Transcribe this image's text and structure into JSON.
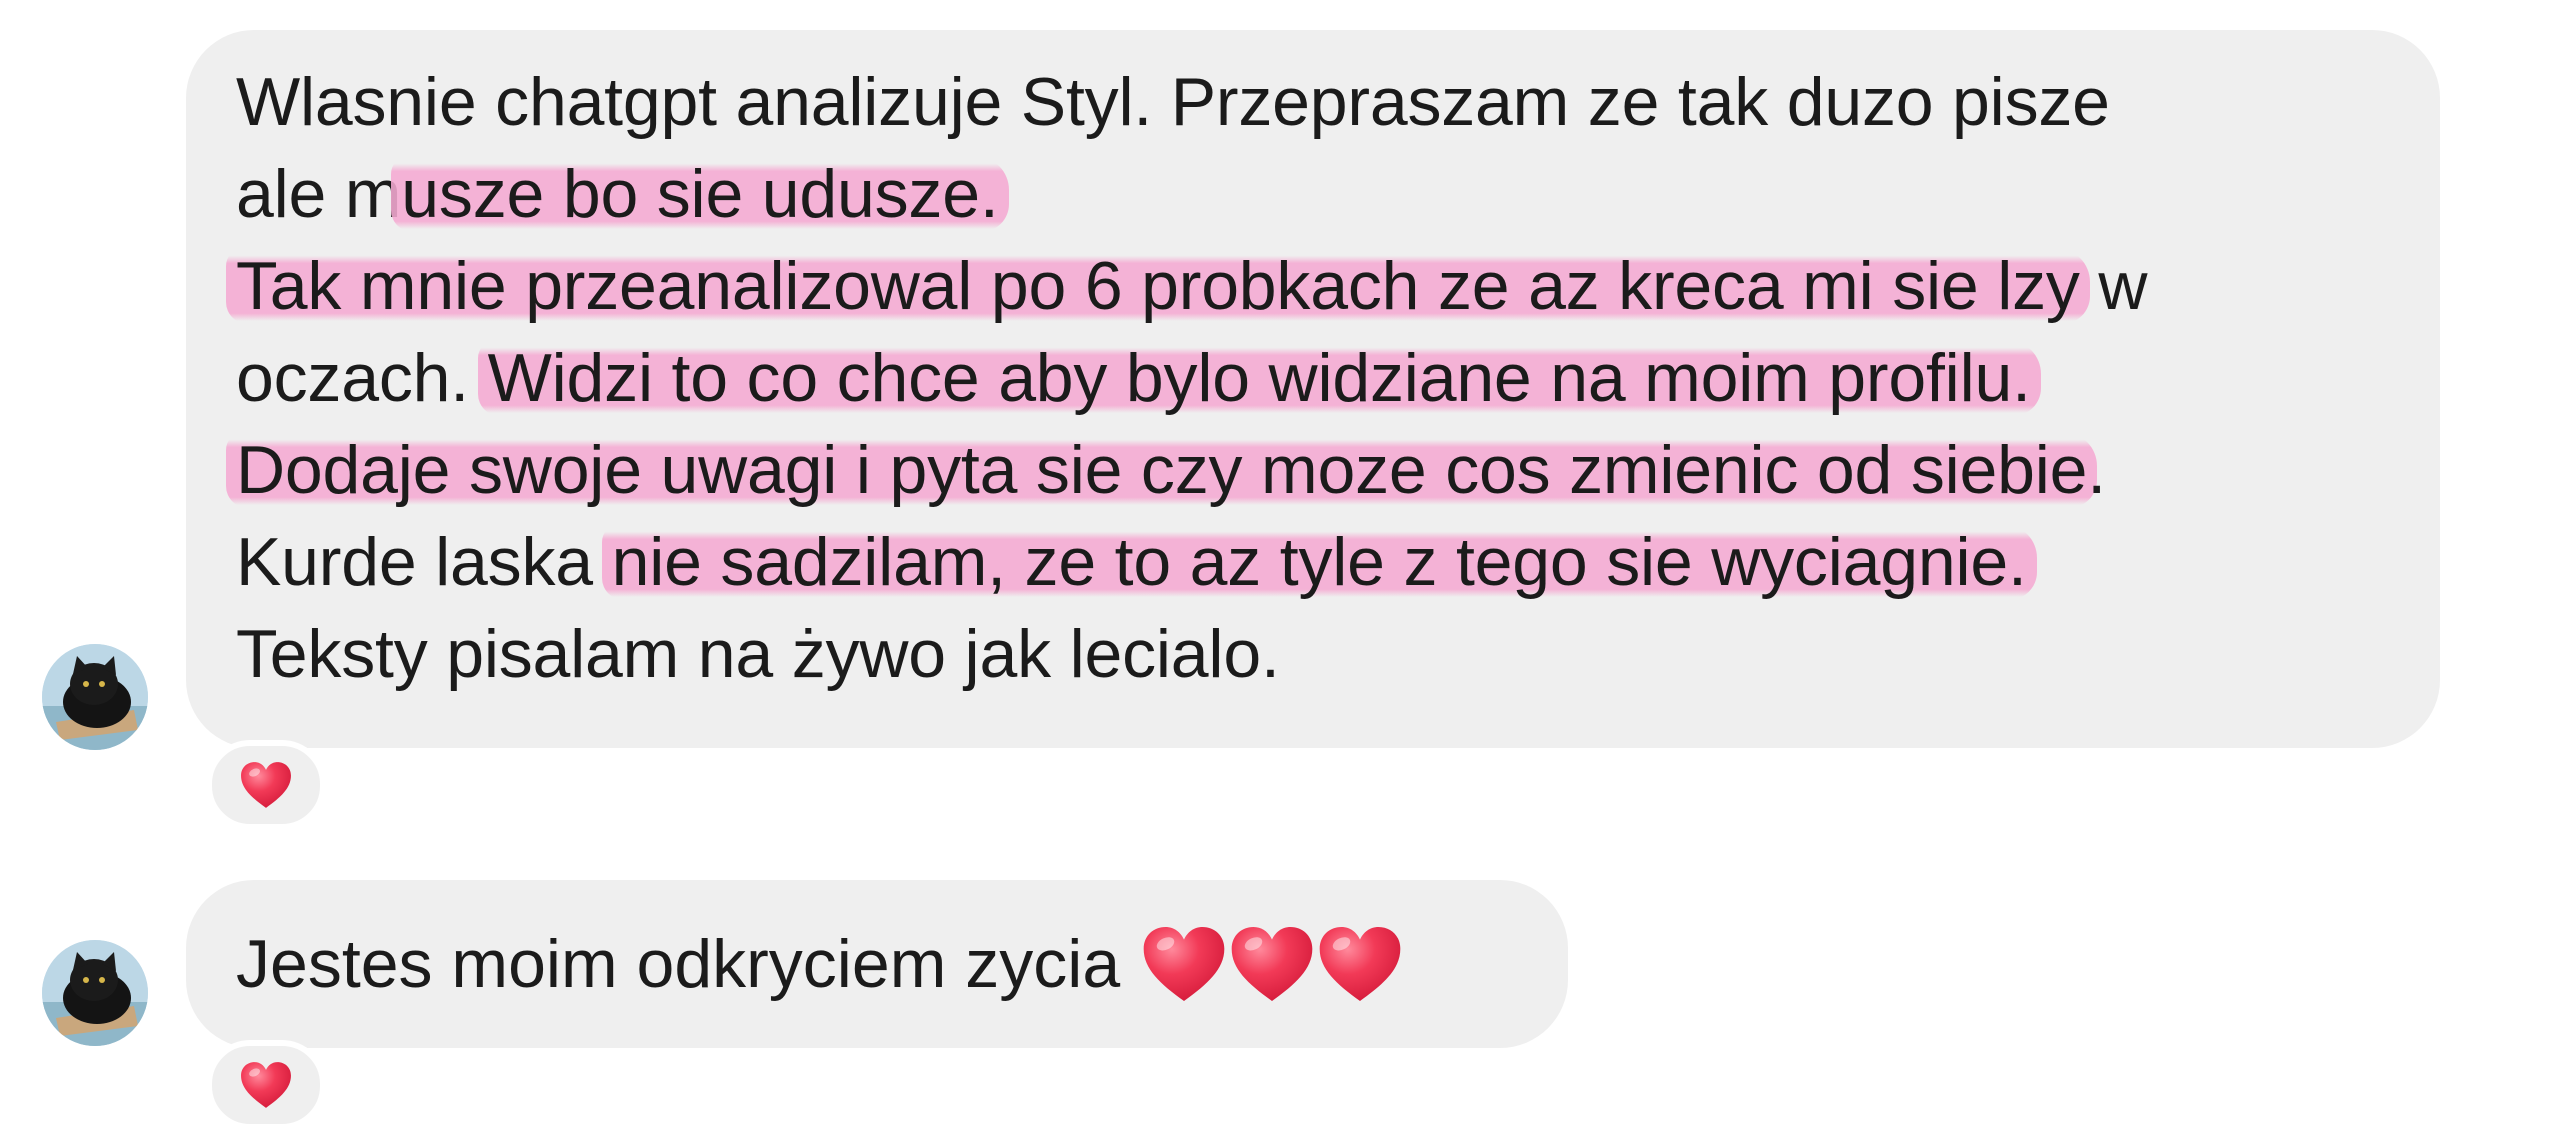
{
  "messages": [
    {
      "lines": [
        {
          "plain": "Wlasnie chatgpt analizuje Styl. Przepraszam ze tak duzo pisze",
          "hl": "",
          "after": ""
        },
        {
          "plain": "ale m",
          "hl": "usze bo sie udusze.",
          "after": ""
        },
        {
          "plain": "",
          "hl": "Tak mnie przeanalizowal po 6 probkach ze az kreca mi sie lzy",
          "after": " w"
        },
        {
          "plain": "oczach. ",
          "hl": "Widzi to co chce aby bylo widziane na moim profilu.",
          "after": ""
        },
        {
          "plain": "",
          "hl": "Dodaje swoje uwagi i pyta sie czy moze cos zmienic od siebie",
          "after": "."
        },
        {
          "plain": "Kurde laska ",
          "hl": "nie sadzilam, ze to az tyle z tego sie wyciagnie.",
          "after": ""
        },
        {
          "plain": "Teksty pisalam na żywo jak lecialo.",
          "hl": "",
          "after": ""
        }
      ],
      "reaction": "heart-icon"
    },
    {
      "text": "Jestes moim odkryciem zycia",
      "emoji": [
        "red-heart-emoji",
        "red-heart-emoji",
        "red-heart-emoji"
      ],
      "reaction": "heart-icon"
    }
  ],
  "colors": {
    "bubble": "#efefef",
    "highlight": "#f5aad2",
    "heart": "#f0324e"
  }
}
